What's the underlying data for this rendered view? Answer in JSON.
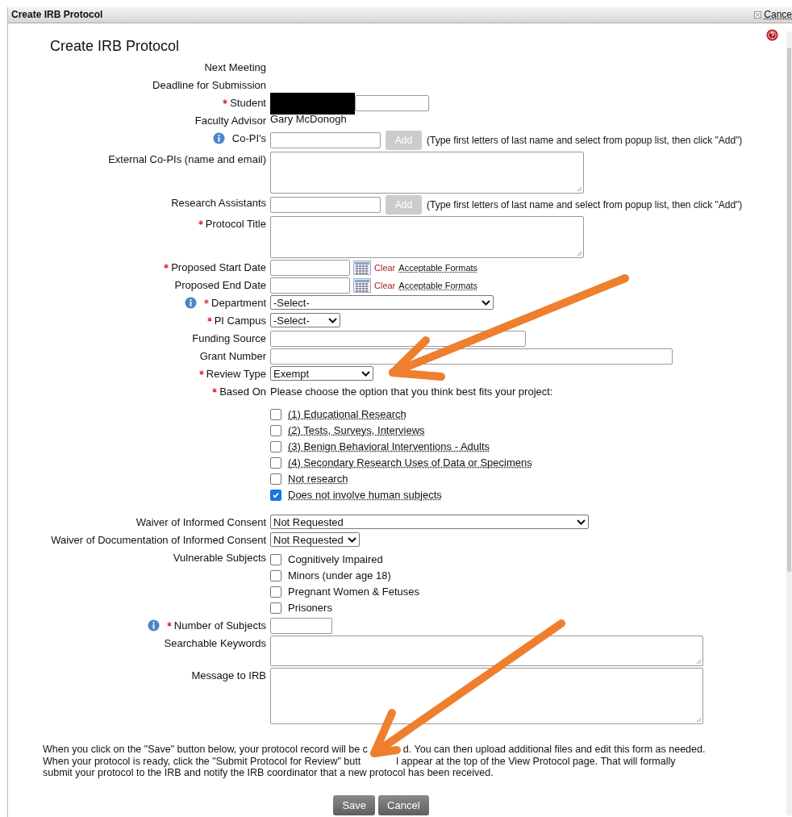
{
  "window": {
    "title": "Create IRB Protocol",
    "close_label": "Cance"
  },
  "heading": "Create IRB Protocol",
  "fields": [
    {
      "kind": "blank",
      "label": "Next Meeting",
      "required": false,
      "info": false
    },
    {
      "kind": "blank",
      "label": "Deadline for Submission",
      "required": false,
      "info": false
    },
    {
      "kind": "input",
      "label": "Student",
      "required": true,
      "info": false,
      "redacted": true
    },
    {
      "kind": "text",
      "label": "Faculty Advisor",
      "required": false,
      "info": false,
      "value": "Gary McDonogh"
    },
    {
      "kind": "input_add",
      "label": "Co-PI's",
      "required": false,
      "info": true,
      "button": {
        "label": "Add",
        "disabled": true
      },
      "hint": "(Type first letters of last name and select from popup list, then click \"Add\")"
    },
    {
      "kind": "textarea",
      "label": "External Co-PIs (name and email)",
      "required": false,
      "info": false
    },
    {
      "kind": "input_add",
      "label": "Research Assistants",
      "required": false,
      "info": false,
      "button": {
        "label": "Add",
        "disabled": true
      },
      "hint": "(Type first letters of last name and select from popup list, then click \"Add\")"
    },
    {
      "kind": "textarea",
      "label": "Protocol Title",
      "required": true,
      "info": false
    },
    {
      "kind": "date",
      "label": "Proposed Start Date",
      "required": true,
      "info": false,
      "clear": "Clear",
      "formats": "Acceptable Formats"
    },
    {
      "kind": "date",
      "label": "Proposed End Date",
      "required": false,
      "info": false,
      "clear": "Clear",
      "formats": "Acceptable Formats"
    },
    {
      "kind": "select",
      "label": "Department",
      "required": true,
      "info": true,
      "value": "-Select-"
    },
    {
      "kind": "select",
      "label": "PI Campus",
      "required": true,
      "info": false,
      "value": "-Select-"
    },
    {
      "kind": "input",
      "label": "Funding Source",
      "required": false,
      "info": false
    },
    {
      "kind": "input",
      "label": "Grant Number",
      "required": false,
      "info": false
    },
    {
      "kind": "select",
      "label": "Review Type",
      "required": true,
      "info": false,
      "value": "Exempt"
    },
    {
      "kind": "options",
      "label": "Based On",
      "required": true,
      "info": false,
      "value": "Please choose the option that you think best fits your project:",
      "options": [
        {
          "label": "(1) Educational Research",
          "checked": false
        },
        {
          "label": "(2) Tests, Surveys, Interviews",
          "checked": false
        },
        {
          "label": "(3) Benign Behavioral Interventions - Adults",
          "checked": false
        },
        {
          "label": "(4) Secondary Research Uses of Data or Specimens",
          "checked": false
        },
        {
          "label": "Not research",
          "checked": false
        },
        {
          "label": "Does not involve human subjects",
          "checked": true
        }
      ]
    },
    {
      "kind": "select",
      "label": "Waiver of Informed Consent",
      "required": false,
      "info": false,
      "value": "Not Requested"
    },
    {
      "kind": "select",
      "label": "Waiver of Documentation of Informed Consent",
      "required": false,
      "info": false,
      "value": "Not Requested"
    },
    {
      "kind": "checklist",
      "label": "Vulnerable Subjects",
      "required": false,
      "info": false,
      "options": [
        {
          "label": "Cognitively Impaired",
          "checked": false
        },
        {
          "label": "Minors (under age 18)",
          "checked": false
        },
        {
          "label": "Pregnant Women & Fetuses",
          "checked": false
        },
        {
          "label": "Prisoners",
          "checked": false
        }
      ]
    },
    {
      "kind": "input",
      "label": "Number of Subjects",
      "required": true,
      "info": true
    },
    {
      "kind": "textarea",
      "label": "Searchable Keywords",
      "required": false,
      "info": false
    },
    {
      "kind": "textarea",
      "label": "Message to IRB",
      "required": false,
      "info": false
    }
  ],
  "note_lines": [
    [
      "When you click on the \"Save\" button below, your protocol record will be c",
      "d. You can then upload additional files and edit this form as needed."
    ],
    [
      "When your protocol is ready, click the \"Submit Protocol for Review\" butt",
      "l appear at the top of the View Protocol page. That will formally"
    ],
    [
      "submit your protocol to the IRB and notify the IRB coordinator that a new protocol has been received."
    ]
  ],
  "buttons": [
    "Save",
    "Cancel"
  ]
}
